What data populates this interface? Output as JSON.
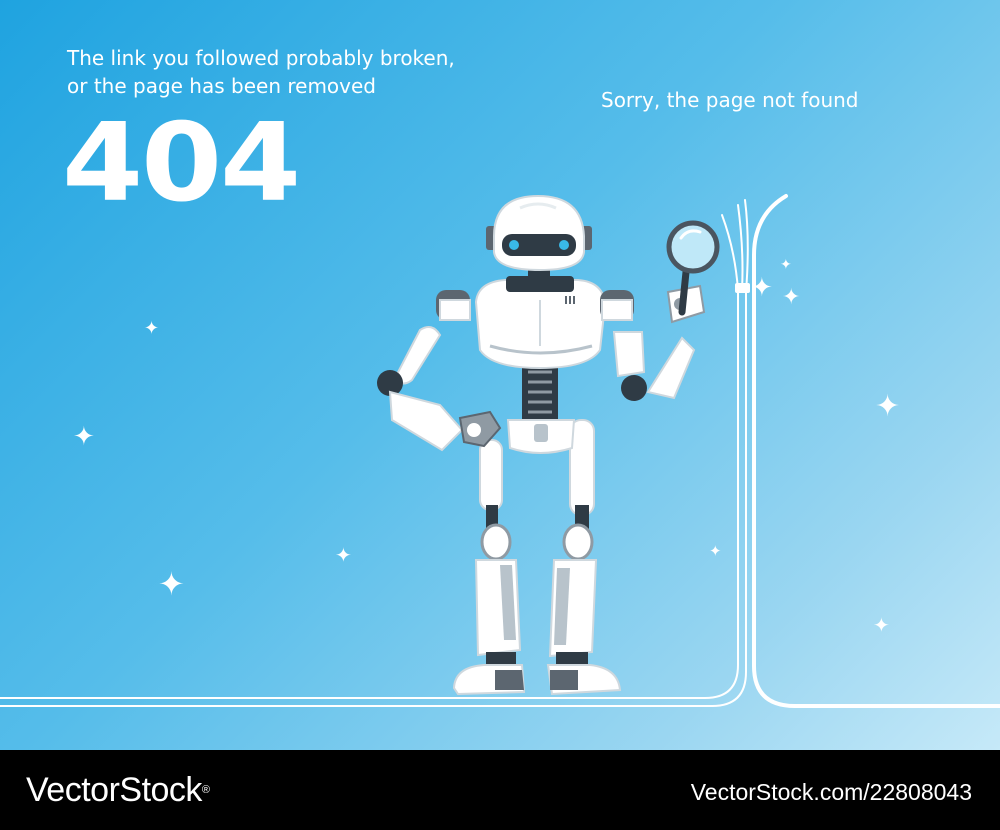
{
  "message": {
    "line1": "The link you followed probably broken,",
    "line2": "or the page has been removed"
  },
  "error_code": "404",
  "sorry": "Sorry, the page not found",
  "sparkle_glyph": "✦",
  "illustration": {
    "subject": "robot-icon",
    "tool": "magnifier-icon"
  },
  "colors": {
    "background_start": "#1fa3e0",
    "background_end": "#c6e9f8",
    "robot_body": "#ffffff",
    "robot_dark": "#2f3b45",
    "robot_eye": "#39b9e8",
    "robot_joint": "#5c6670",
    "footer": "#000000",
    "text": "#ffffff"
  },
  "footer": {
    "brand": "VectorStock",
    "registered_mark": "®",
    "stock_id": "VectorStock.com/22808043"
  }
}
